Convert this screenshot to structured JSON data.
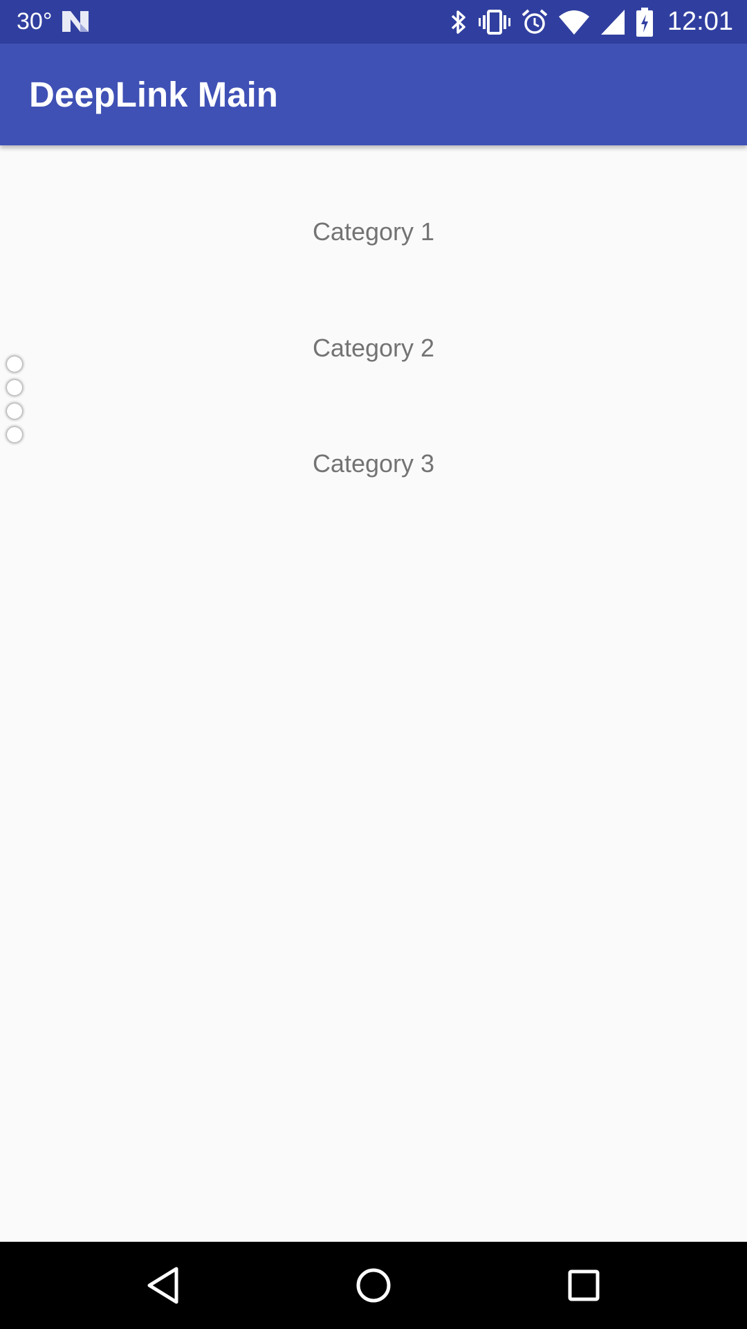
{
  "status_bar": {
    "temperature": "30°",
    "time": "12:01",
    "icons": [
      "n-notification-icon",
      "bluetooth-icon",
      "vibrate-icon",
      "alarm-icon",
      "wifi-icon",
      "cell-signal-icon",
      "battery-icon"
    ]
  },
  "app_bar": {
    "title": "DeepLink Main"
  },
  "categories": [
    {
      "label": "Category 1"
    },
    {
      "label": "Category 2"
    },
    {
      "label": "Category 3"
    }
  ],
  "nav_bar": {
    "buttons": [
      "back-button",
      "home-button",
      "recents-button"
    ]
  },
  "colors": {
    "status_bar": "#303f9f",
    "app_bar": "#3f51b5",
    "background": "#fafafa",
    "category_text": "#737373",
    "nav_bar": "#000000"
  }
}
